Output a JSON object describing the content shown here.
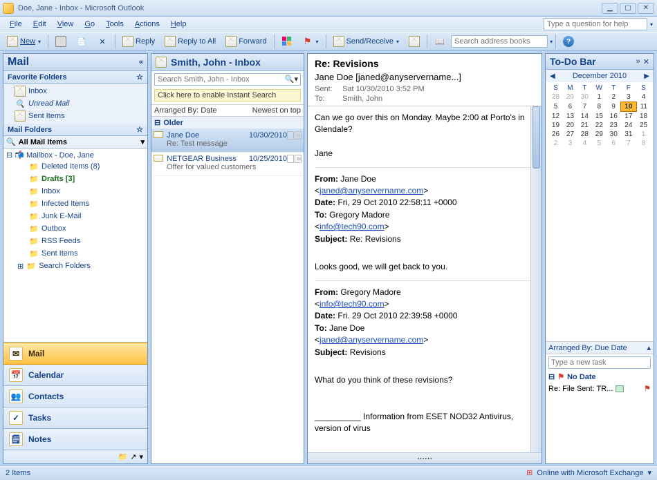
{
  "window": {
    "title": "Doe, Jane - Inbox - Microsoft Outlook"
  },
  "menu": {
    "items": [
      "File",
      "Edit",
      "View",
      "Go",
      "Tools",
      "Actions",
      "Help"
    ],
    "help_placeholder": "Type a question for help"
  },
  "toolbar": {
    "new": "New",
    "reply": "Reply",
    "reply_all": "Reply to All",
    "forward": "Forward",
    "send_receive": "Send/Receive",
    "search_placeholder": "Search address books"
  },
  "nav": {
    "title": "Mail",
    "fav_header": "Favorite Folders",
    "fav_items": [
      "Inbox",
      "Unread Mail",
      "Sent Items"
    ],
    "folders_header": "Mail Folders",
    "all_mail": "All Mail Items",
    "mailbox_root": "Mailbox - Doe, Jane",
    "tree": [
      {
        "label": "Deleted Items",
        "suffix": "(8)",
        "icon": "trash"
      },
      {
        "label": "Drafts",
        "suffix": "[3]",
        "icon": "draft",
        "bold": true
      },
      {
        "label": "Inbox",
        "icon": "inbox"
      },
      {
        "label": "Infected Items",
        "icon": "folder"
      },
      {
        "label": "Junk E-Mail",
        "icon": "junk"
      },
      {
        "label": "Outbox",
        "icon": "outbox"
      },
      {
        "label": "RSS Feeds",
        "icon": "rss"
      },
      {
        "label": "Sent Items",
        "icon": "sent"
      },
      {
        "label": "Search Folders",
        "icon": "search",
        "expander": true
      }
    ],
    "bignav": [
      "Mail",
      "Calendar",
      "Contacts",
      "Tasks",
      "Notes"
    ]
  },
  "list": {
    "header": "Smith, John - Inbox",
    "search_placeholder": "Search Smith, John - Inbox",
    "instant_search": "Click here to enable Instant Search",
    "arranged_label": "Arranged By: Date",
    "arranged_right": "Newest on top",
    "group": "Older",
    "messages": [
      {
        "from": "Jane Doe",
        "date": "10/30/2010",
        "subject": "Re: Test message",
        "selected": true
      },
      {
        "from": "NETGEAR Business",
        "date": "10/25/2010",
        "subject": "Offer for valued customers",
        "selected": false
      }
    ]
  },
  "reading": {
    "subject": "Re: Revisions",
    "from_display": "Jane Doe [janed@anyservername...]",
    "sent_label": "Sent:",
    "sent_value": "Sat 10/30/2010 3:52 PM",
    "to_label": "To:",
    "to_value": "Smith, John",
    "body_para1": "Can we go over this on Monday. Maybe 2:00 at Porto's in Glendale?",
    "body_sig": "Jane",
    "q1_from_label": "From:",
    "q1_from": "Jane  Doe",
    "q1_from_email": "janed@anyservername.com",
    "q1_date_label": "Date:",
    "q1_date": "Fri, 29 Oct 2010 22:58:11 +0000",
    "q1_to_label": "To:",
    "q1_to": "Gregory Madore",
    "q1_to_email": "info@tech90.com",
    "q1_subj_label": "Subject:",
    "q1_subj": "Re: Revisions",
    "q1_body": "Looks good, we will get back to you.",
    "q2_from_label": "From:",
    "q2_from": "Gregory Madore",
    "q2_from_email": "info@tech90.com",
    "q2_date_label": "Date:",
    "q2_date": "Fri. 29 Oct 2010 22:39:58 +0000",
    "q2_to_label": "To:",
    "q2_to": "Jane  Doe",
    "q2_to_email": "janed@anyservername.com",
    "q2_subj_label": "Subject:",
    "q2_subj": "Revisions",
    "q2_body": "What do you think of these revisions?",
    "footer_line": "__________ Information from ESET NOD32 Antivirus, version of virus"
  },
  "todo": {
    "header": "To-Do Bar",
    "month": "December 2010",
    "dow": [
      "S",
      "M",
      "T",
      "W",
      "T",
      "F",
      "S"
    ],
    "weeks": [
      [
        {
          "d": 28,
          "dim": true
        },
        {
          "d": 29,
          "dim": true
        },
        {
          "d": 30,
          "dim": true
        },
        {
          "d": 1
        },
        {
          "d": 2
        },
        {
          "d": 3
        },
        {
          "d": 4
        }
      ],
      [
        {
          "d": 5
        },
        {
          "d": 6
        },
        {
          "d": 7
        },
        {
          "d": 8
        },
        {
          "d": 9
        },
        {
          "d": 10,
          "today": true
        },
        {
          "d": 11
        }
      ],
      [
        {
          "d": 12
        },
        {
          "d": 13
        },
        {
          "d": 14
        },
        {
          "d": 15
        },
        {
          "d": 16
        },
        {
          "d": 17
        },
        {
          "d": 18
        }
      ],
      [
        {
          "d": 19
        },
        {
          "d": 20
        },
        {
          "d": 21
        },
        {
          "d": 22
        },
        {
          "d": 23
        },
        {
          "d": 24
        },
        {
          "d": 25
        }
      ],
      [
        {
          "d": 26
        },
        {
          "d": 27
        },
        {
          "d": 28
        },
        {
          "d": 29
        },
        {
          "d": 30
        },
        {
          "d": 31
        },
        {
          "d": 1,
          "dim": true
        }
      ],
      [
        {
          "d": 2,
          "dim": true
        },
        {
          "d": 3,
          "dim": true
        },
        {
          "d": 4,
          "dim": true
        },
        {
          "d": 5,
          "dim": true
        },
        {
          "d": 6,
          "dim": true
        },
        {
          "d": 7,
          "dim": true
        },
        {
          "d": 8,
          "dim": true
        }
      ]
    ],
    "arrange": "Arranged By: Due Date",
    "new_task_placeholder": "Type a new task",
    "group": "No Date",
    "task": "Re: File Sent: TR..."
  },
  "status": {
    "left": "2 Items",
    "right": "Online with Microsoft Exchange"
  }
}
